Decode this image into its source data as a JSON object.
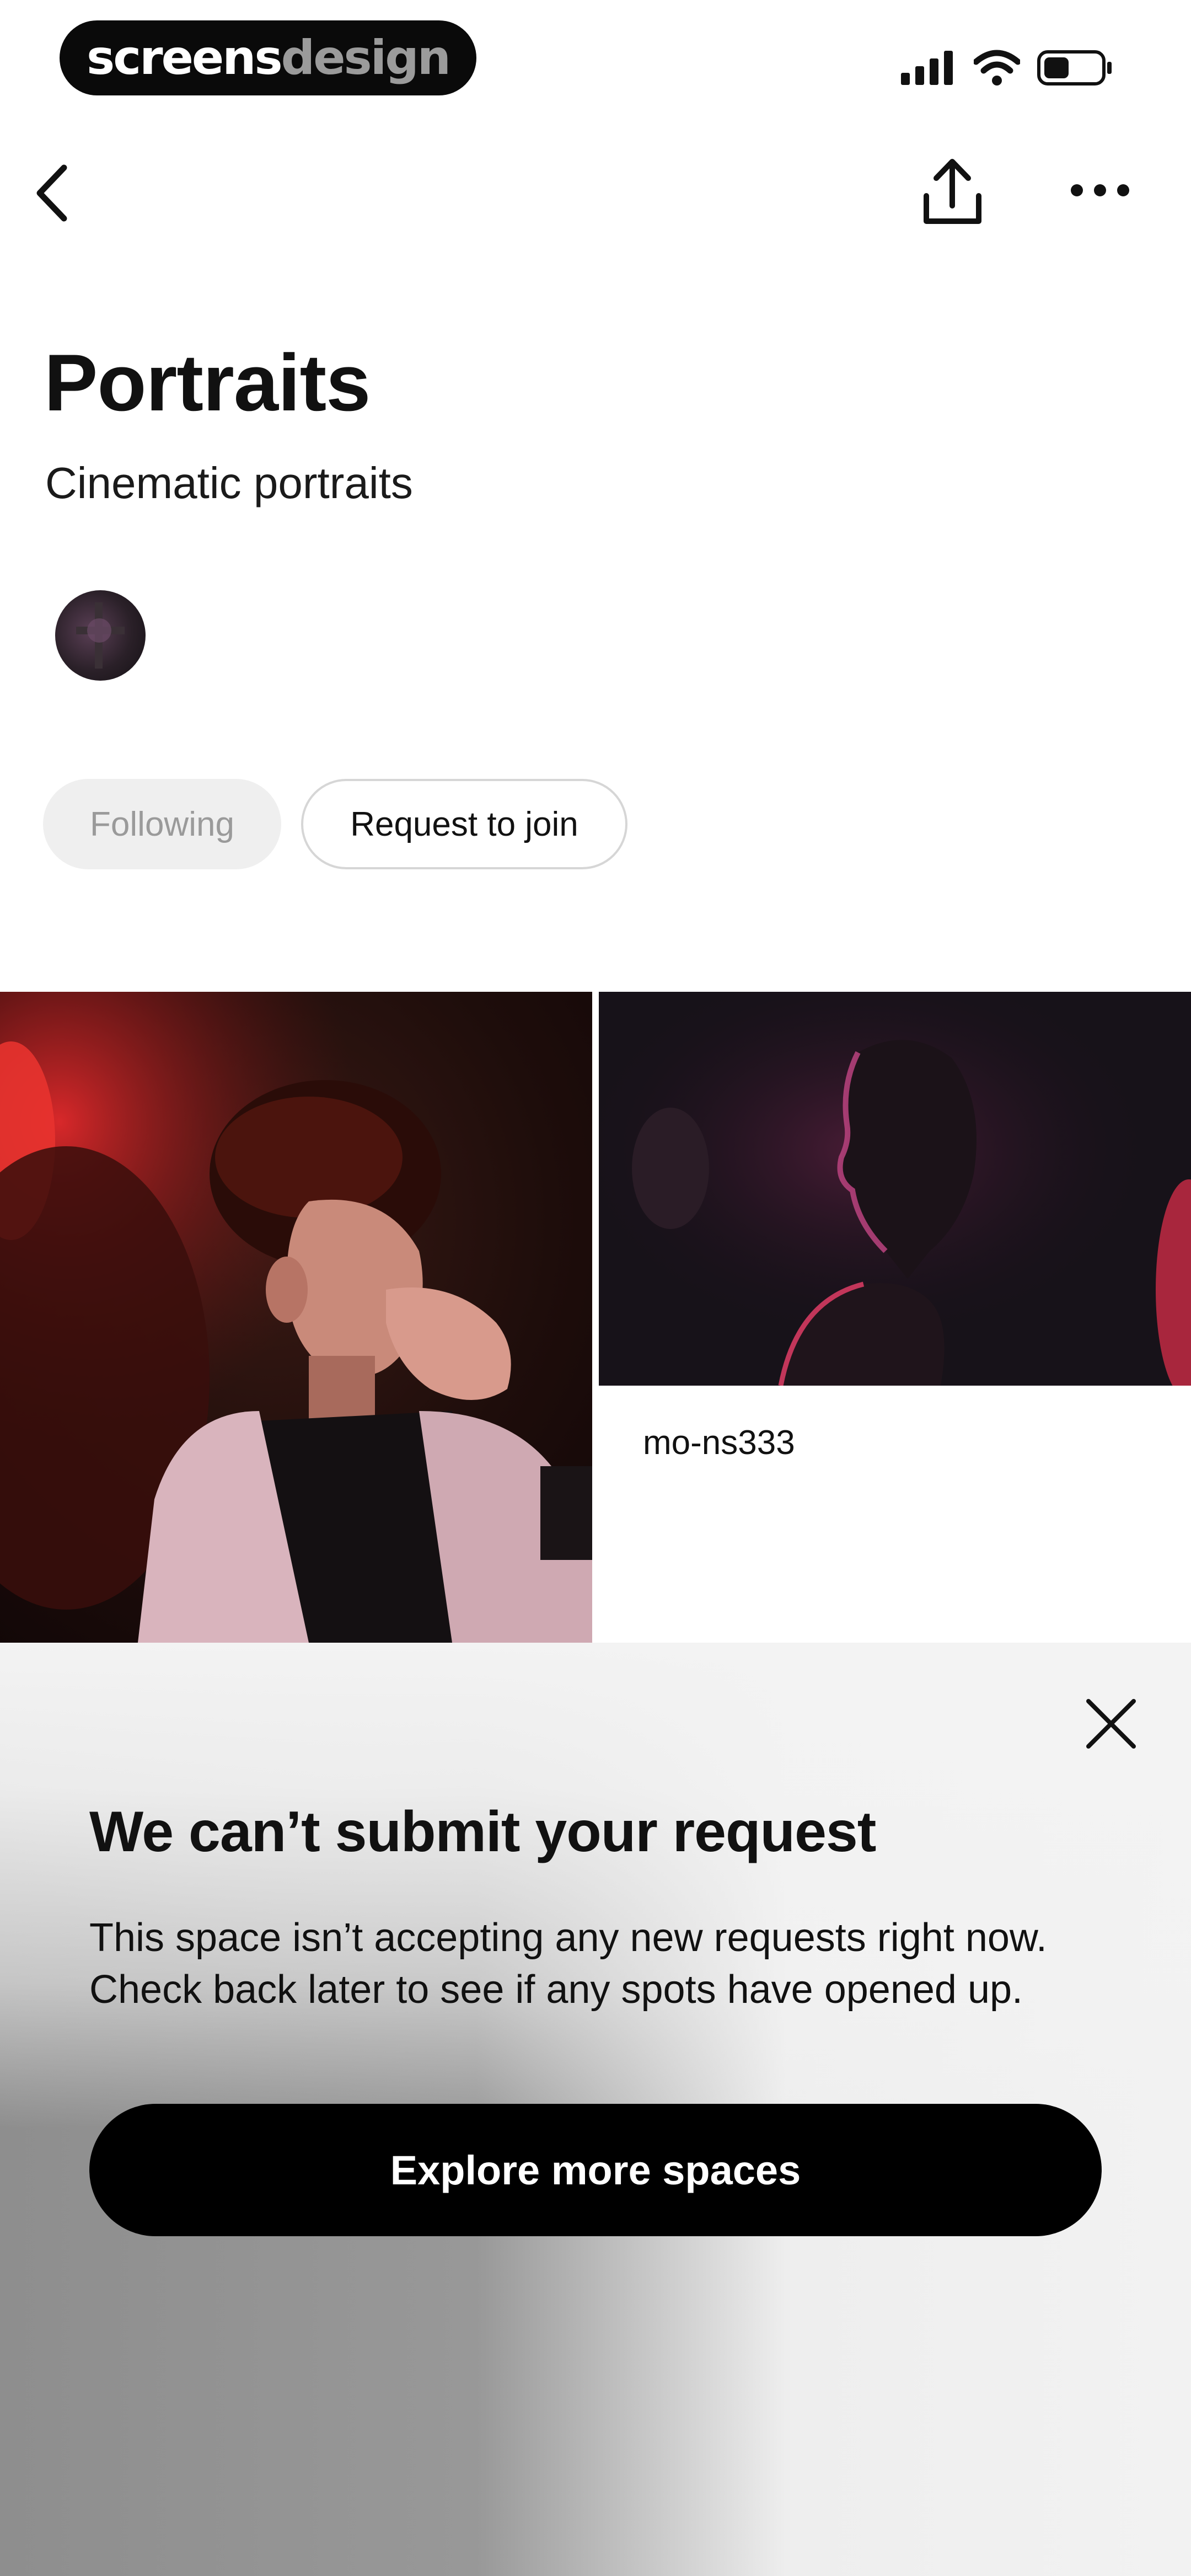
{
  "status_bar": {
    "brand_primary": "screens",
    "brand_secondary": "design",
    "icons": [
      "signal-icon",
      "wifi-icon",
      "battery-icon"
    ]
  },
  "nav": {
    "icons": [
      "back-chevron-icon",
      "share-icon",
      "more-icon"
    ]
  },
  "header": {
    "title": "Portraits",
    "subtitle": "Cinematic portraits"
  },
  "actions": {
    "following_label": "Following",
    "request_label": "Request to join"
  },
  "grid": {
    "items": [
      {
        "caption": ""
      },
      {
        "caption": "mo-ns333"
      }
    ]
  },
  "sheet": {
    "title": "We can’t submit your request",
    "body_line1": "This space isn’t accepting any new requests right now.",
    "body_line2": "Check back later to see if any spots have opened up.",
    "cta_label": "Explore more spaces"
  },
  "colors": {
    "cta_bg": "#000000",
    "following_bg": "#efefef",
    "following_text": "#9a9a9a",
    "request_border": "#d6d6d6"
  }
}
